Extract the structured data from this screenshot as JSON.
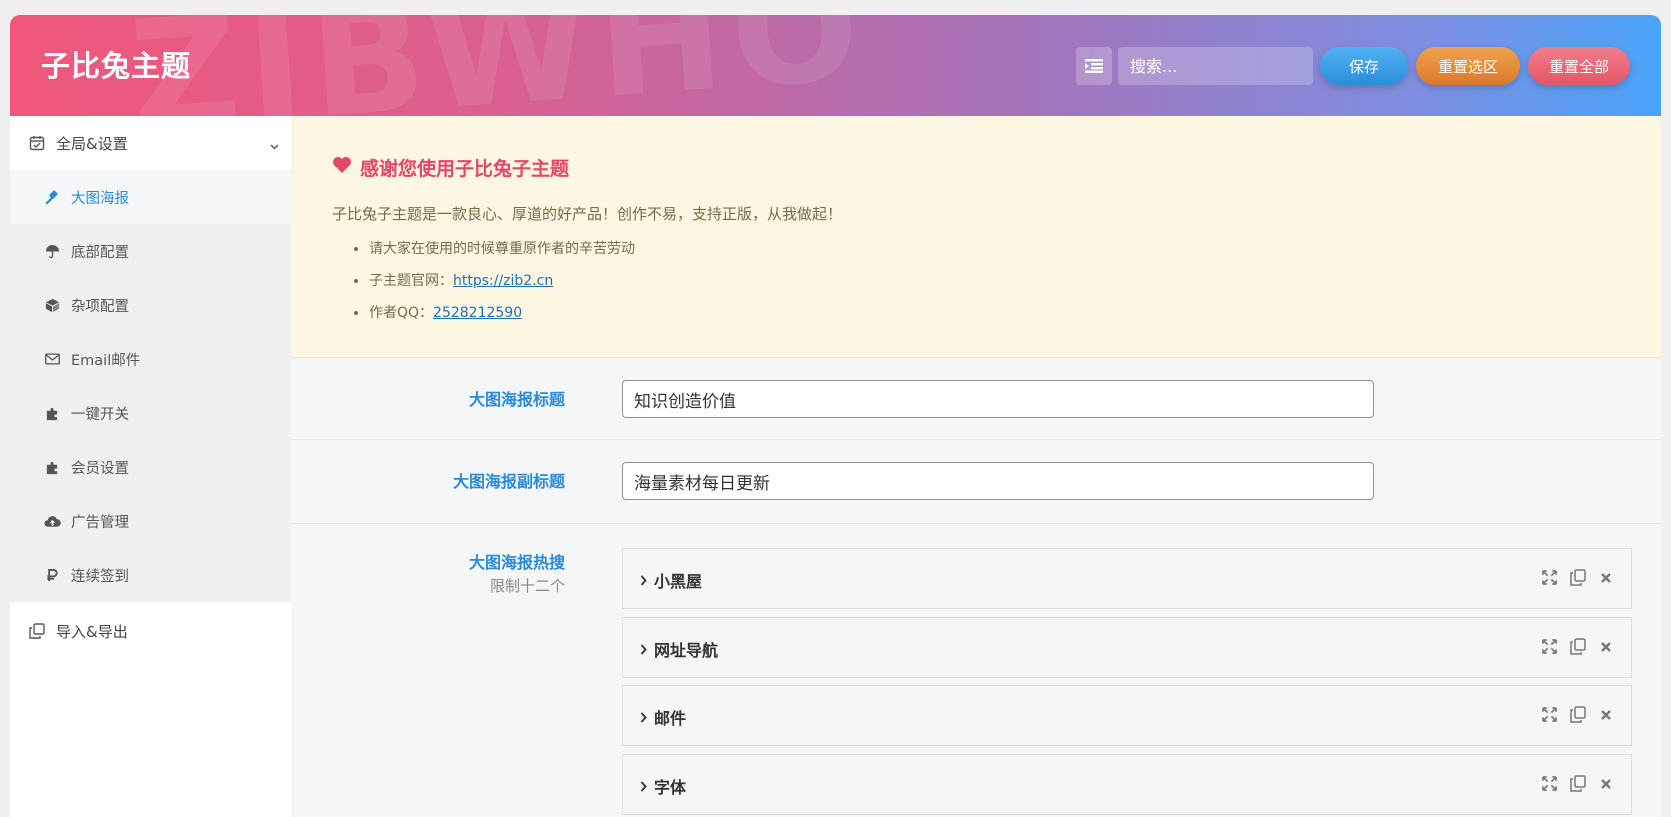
{
  "header": {
    "title": "子比兔主题",
    "watermark": "ZIBWHO",
    "search_placeholder": "搜索...",
    "save_label": "保存",
    "reset_section_label": "重置选区",
    "reset_all_label": "重置全部"
  },
  "sidebar": {
    "section_label": "全局&设置",
    "items": [
      {
        "label": "大图海报",
        "icon": "gavel-icon",
        "active": true
      },
      {
        "label": "底部配置",
        "icon": "umbrella-icon"
      },
      {
        "label": "杂项配置",
        "icon": "cube-icon"
      },
      {
        "label": "Email邮件",
        "icon": "envelope-icon"
      },
      {
        "label": "一键开关",
        "icon": "puzzle-icon"
      },
      {
        "label": "会员设置",
        "icon": "puzzle-icon"
      },
      {
        "label": "广告管理",
        "icon": "cloud-upload-icon"
      },
      {
        "label": "连续签到",
        "icon": "ruble-icon"
      }
    ],
    "bottom_label": "导入&导出"
  },
  "notice": {
    "title": "感谢您使用子比兔子主题",
    "text": "子比兔子主题是一款良心、厚道的好产品！创作不易，支持正版，从我做起！",
    "list": {
      "item1": "请大家在使用的时候尊重原作者的辛苦劳动",
      "item2_prefix": "子主题官网：",
      "item2_link": "https://zib2.cn",
      "item3_prefix": "作者QQ：",
      "item3_link": "2528212590"
    }
  },
  "fields": {
    "title_label": "大图海报标题",
    "title_value": "知识创造价值",
    "subtitle_label": "大图海报副标题",
    "subtitle_value": "海量素材每日更新",
    "hot_label": "大图海报热搜",
    "hot_sublabel": "限制十二个",
    "groups": [
      "小黑屋",
      "网址导航",
      "邮件",
      "字体"
    ]
  },
  "colors": {
    "accent": "#2a8bd8",
    "notice_title": "#e5476a",
    "notice_bg": "#fcf6e2"
  }
}
